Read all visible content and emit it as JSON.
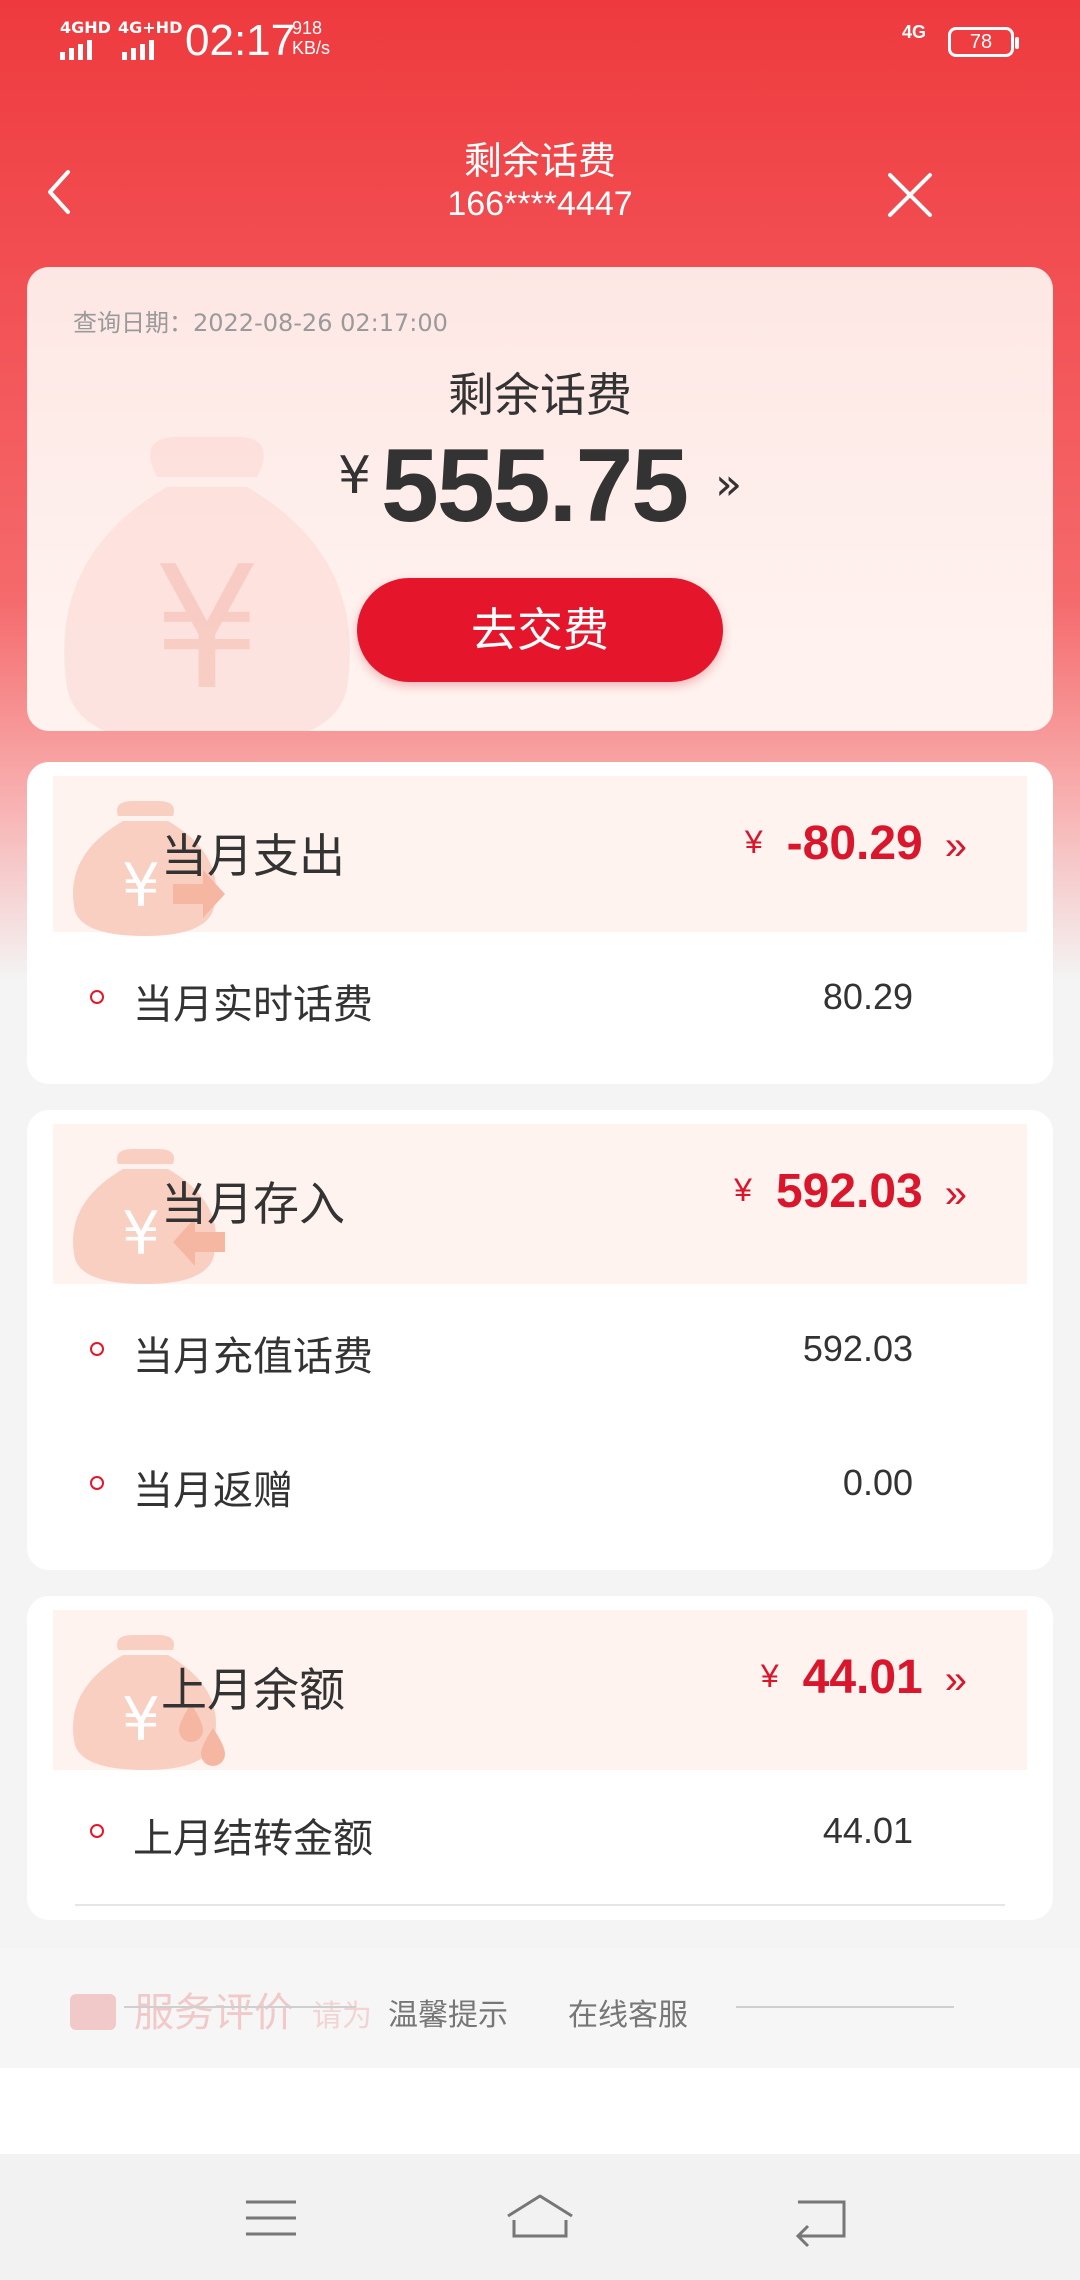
{
  "status_bar": {
    "network1": "4GHD",
    "network2": "4G+HD",
    "time": "02:17",
    "speed_value": "918",
    "speed_unit": "KB/s",
    "network_right": "4G",
    "battery": "78"
  },
  "header": {
    "title": "剩余话费",
    "phone": "166****4447"
  },
  "balance_card": {
    "query_date": "查询日期：2022-08-26 02:17:00",
    "label": "剩余话费",
    "currency": "¥",
    "amount": "555.75",
    "more": "»",
    "pay_button": "去交费"
  },
  "sections": [
    {
      "title": "当月支出",
      "currency": "¥",
      "amount": "-80.29",
      "chevron": "»",
      "rows": [
        {
          "label": "当月实时话费",
          "value": "80.29"
        }
      ]
    },
    {
      "title": "当月存入",
      "currency": "¥",
      "amount": "592.03",
      "chevron": "»",
      "rows": [
        {
          "label": "当月充值话费",
          "value": "592.03"
        },
        {
          "label": "当月返赠",
          "value": "0.00"
        }
      ]
    },
    {
      "title": "上月余额",
      "currency": "¥",
      "amount": "44.01",
      "chevron": "»",
      "rows": [
        {
          "label": "上月结转金额",
          "value": "44.01"
        }
      ]
    }
  ],
  "footer": {
    "service_rating": "服务评价",
    "service_sub": "请为",
    "tips": "温馨提示",
    "online_service": "在线客服"
  },
  "colors": {
    "accent": "#e5162b",
    "hero_top": "#ee3a3e"
  }
}
